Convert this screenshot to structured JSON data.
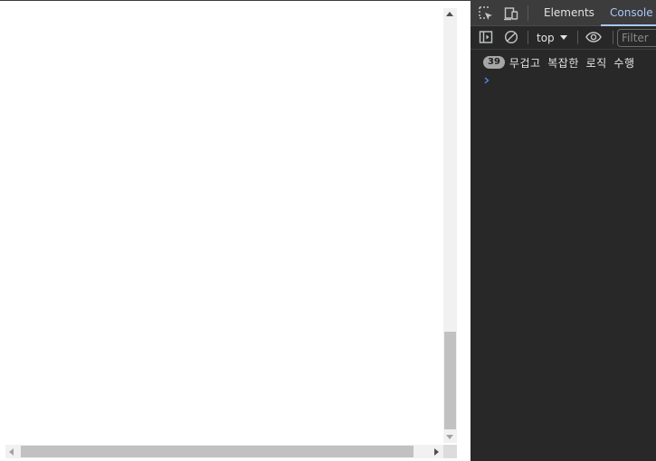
{
  "devtools": {
    "tabs": [
      {
        "label": "Elements"
      },
      {
        "label": "Console"
      }
    ],
    "active_tab": "Console",
    "accent_color": "#a8c7fa",
    "background_color": "#282828",
    "toolbar": {
      "context_label": "top",
      "filter_placeholder": "Filter"
    },
    "console": {
      "messages": [
        {
          "count": "39",
          "text": "무겁고 복잡한 로직 수행"
        }
      ]
    },
    "icons": [
      "inspect-element-icon",
      "device-toolbar-icon",
      "sidebar-toggle-icon",
      "clear-console-icon",
      "dropdown-arrow-icon",
      "eye-icon",
      "prompt-chevron-icon"
    ]
  }
}
